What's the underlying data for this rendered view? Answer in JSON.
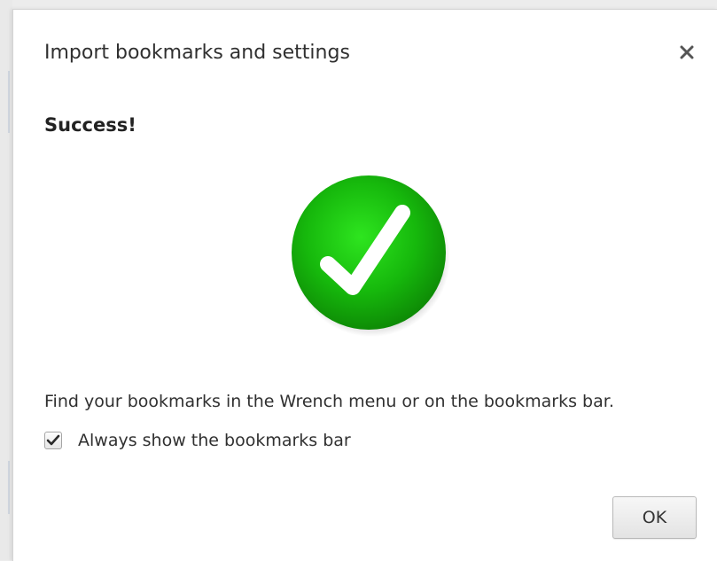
{
  "dialog": {
    "title": "Import bookmarks and settings",
    "close_icon": "close-icon",
    "heading": "Success!",
    "status_icon": "checkmark-success-icon",
    "message": "Find your bookmarks in the Wrench menu or on the bookmarks bar.",
    "checkbox": {
      "label": "Always show the bookmarks bar",
      "checked": true
    },
    "ok_label": "OK"
  },
  "colors": {
    "success_green": "#19b40f",
    "dialog_bg": "#ffffff",
    "backdrop": "#ececec"
  }
}
